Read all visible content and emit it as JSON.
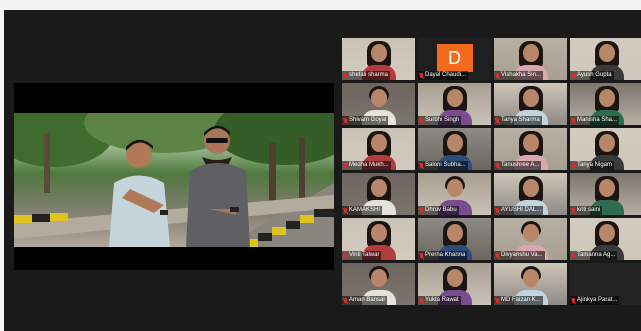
{
  "meeting": {
    "shared_screen": {
      "scene": "two-men-outdoors-with-phones"
    },
    "participants": [
      {
        "name": "shefali sharma",
        "style": "woman"
      },
      {
        "name": "Dayal Chaudi...",
        "style": "avatar",
        "initial": "D"
      },
      {
        "name": "Vishakha Sin...",
        "style": "woman"
      },
      {
        "name": "Ayush Gupta",
        "style": "woman"
      },
      {
        "name": "Shivam Goyal",
        "style": "man"
      },
      {
        "name": "Surbhi Singh",
        "style": "woman"
      },
      {
        "name": "Tanya Sharma",
        "style": "woman"
      },
      {
        "name": "Manisha Sha...",
        "style": "woman"
      },
      {
        "name": "Medha Mukh...",
        "style": "woman"
      },
      {
        "name": "Saloni Subha...",
        "style": "woman"
      },
      {
        "name": "Tanushree A...",
        "style": "woman"
      },
      {
        "name": "Tanya Nigam",
        "style": "woman"
      },
      {
        "name": "KAMAKSHI",
        "style": "woman"
      },
      {
        "name": "Dhruv Babu",
        "style": "man"
      },
      {
        "name": "AYUSHI DAL...",
        "style": "woman"
      },
      {
        "name": "kriti saini",
        "style": "woman"
      },
      {
        "name": "Vinti Talwar",
        "style": "woman"
      },
      {
        "name": "Prerna Khanna",
        "style": "woman"
      },
      {
        "name": "Divyanshu Va...",
        "style": "man"
      },
      {
        "name": "Tamanna Ag...",
        "style": "woman"
      },
      {
        "name": "Aman Bansal",
        "style": "man"
      },
      {
        "name": "Yukta Rawat",
        "style": "woman"
      },
      {
        "name": "MD Faizan K...",
        "style": "man"
      },
      {
        "name": "Ajinkya Parat...",
        "style": "empty"
      }
    ],
    "colors": {
      "window_bg": "#1a1a1a",
      "muted_mic": "#e02a2a",
      "avatar_bg": "#f26b1d"
    }
  }
}
